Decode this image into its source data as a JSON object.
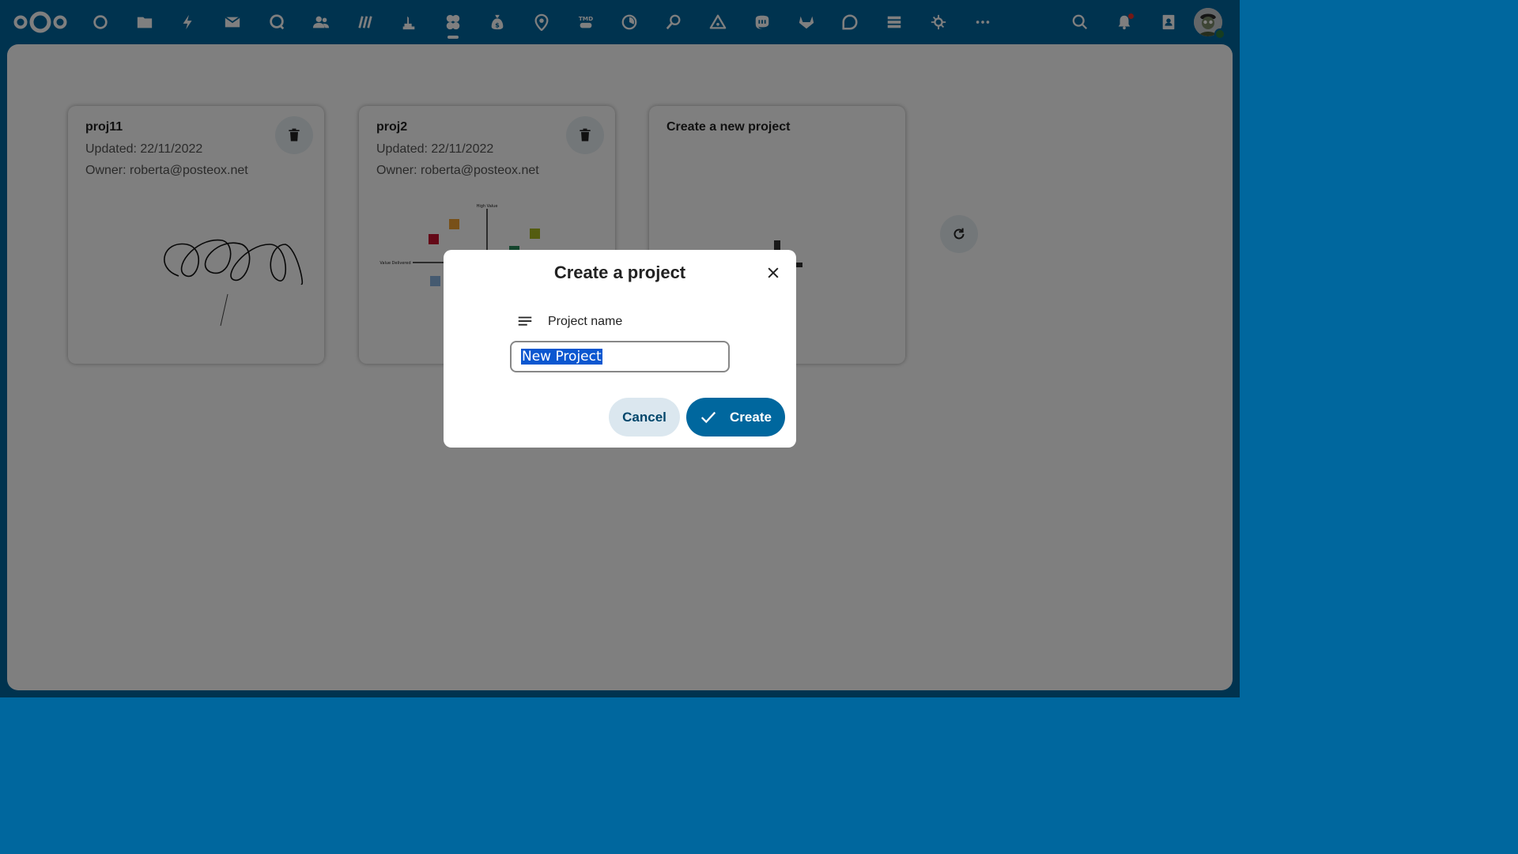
{
  "topbar": {
    "apps": [
      {
        "name": "dashboard",
        "icon": "circle-icon"
      },
      {
        "name": "files",
        "icon": "folder-icon"
      },
      {
        "name": "activity",
        "icon": "bolt-icon"
      },
      {
        "name": "mail",
        "icon": "mail-icon"
      },
      {
        "name": "talk",
        "icon": "chat-bubble-icon"
      },
      {
        "name": "contacts",
        "icon": "people-icon"
      },
      {
        "name": "deck",
        "icon": "deck-icon"
      },
      {
        "name": "maps-photos",
        "icon": "statue-icon"
      },
      {
        "name": "whiteboard",
        "icon": "clover-icon",
        "active": true
      },
      {
        "name": "cospend",
        "icon": "money-bag-icon"
      },
      {
        "name": "maps",
        "icon": "map-pin-icon"
      },
      {
        "name": "tmdb",
        "icon": "tmdb-icon"
      },
      {
        "name": "tasks",
        "icon": "progress-icon"
      },
      {
        "name": "search-users",
        "icon": "magnifier-people-icon"
      },
      {
        "name": "drop",
        "icon": "triangle-icon"
      },
      {
        "name": "mastodon",
        "icon": "mastodon-icon"
      },
      {
        "name": "gitlab",
        "icon": "gitlab-icon"
      },
      {
        "name": "discourse",
        "icon": "discourse-icon"
      },
      {
        "name": "stack",
        "icon": "stack-icon"
      },
      {
        "name": "astro",
        "icon": "star-orbit-icon"
      },
      {
        "name": "more",
        "icon": "more-icon"
      }
    ]
  },
  "projects": [
    {
      "title": "proj11",
      "updated": "Updated: 22/11/2022",
      "owner": "Owner: roberta@posteox.net"
    },
    {
      "title": "proj2",
      "updated": "Updated: 22/11/2022",
      "owner": "Owner: roberta@posteox.net",
      "preview_labels": {
        "top": "High Value",
        "left": "Value Delivered"
      }
    },
    {
      "title": "Create a new project"
    }
  ],
  "modal": {
    "title": "Create a project",
    "field_label": "Project name",
    "field_value": "New Project",
    "cancel_label": "Cancel",
    "create_label": "Create"
  },
  "colors": {
    "brand": "#00679e",
    "overlay": "rgba(0,0,0,0.5)",
    "notification": "#e9322d",
    "online": "#2d7b41"
  }
}
